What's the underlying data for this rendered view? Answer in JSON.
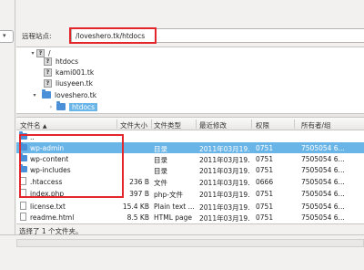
{
  "site": {
    "label": "远程站点:",
    "path": "/loveshero.tk/htdocs"
  },
  "tree": [
    {
      "label": "/",
      "icon": "question-icon",
      "expanded": true
    },
    {
      "label": "htdocs",
      "icon": "question-icon"
    },
    {
      "label": "kami001.tk",
      "icon": "question-icon"
    },
    {
      "label": "liusyeen.tk",
      "icon": "question-icon"
    },
    {
      "label": "loveshero.tk",
      "icon": "folder-icon",
      "expanded": true
    },
    {
      "label": "htdocs",
      "icon": "folder-icon",
      "selected": true
    }
  ],
  "columns": {
    "name": "文件名",
    "sort_arrow": "▲",
    "size": "文件大小",
    "type": "文件类型",
    "modified": "最近修改",
    "perms": "权限",
    "owner": "所有者/组"
  },
  "files": [
    {
      "name": "..",
      "size": "",
      "type": "",
      "modified": "",
      "perms": "",
      "owner": "",
      "icon": "folder-icon"
    },
    {
      "name": "wp-admin",
      "size": "",
      "type": "目录",
      "modified": "2011年03月19...",
      "perms": "0751",
      "owner": "7505054 6...",
      "icon": "folder-icon",
      "selected": true
    },
    {
      "name": "wp-content",
      "size": "",
      "type": "目录",
      "modified": "2011年03月19...",
      "perms": "0751",
      "owner": "7505054 6...",
      "icon": "folder-icon"
    },
    {
      "name": "wp-includes",
      "size": "",
      "type": "目录",
      "modified": "2011年03月19...",
      "perms": "0751",
      "owner": "7505054 6...",
      "icon": "folder-icon"
    },
    {
      "name": ".htaccess",
      "size": "236 B",
      "type": "文件",
      "modified": "2011年03月19...",
      "perms": "0666",
      "owner": "7505054 6...",
      "icon": "document-icon"
    },
    {
      "name": "index.php",
      "size": "397 B",
      "type": "php-文件",
      "modified": "2011年03月19...",
      "perms": "0751",
      "owner": "7505054 6...",
      "icon": "document-icon"
    },
    {
      "name": "license.txt",
      "size": "15.4 KB",
      "type": "Plain text ...",
      "modified": "2011年03月19...",
      "perms": "0751",
      "owner": "7505054 6...",
      "icon": "document-icon"
    },
    {
      "name": "readme.html",
      "size": "8.5 KB",
      "type": "HTML page",
      "modified": "2011年03月19...",
      "perms": "0751",
      "owner": "7505054 6...",
      "icon": "document-icon"
    }
  ],
  "status": "选择了 1 个文件夹。",
  "colors": {
    "selection": "#6ab5e8",
    "folder": "#4a90d9",
    "highlight": "#e3262b"
  }
}
